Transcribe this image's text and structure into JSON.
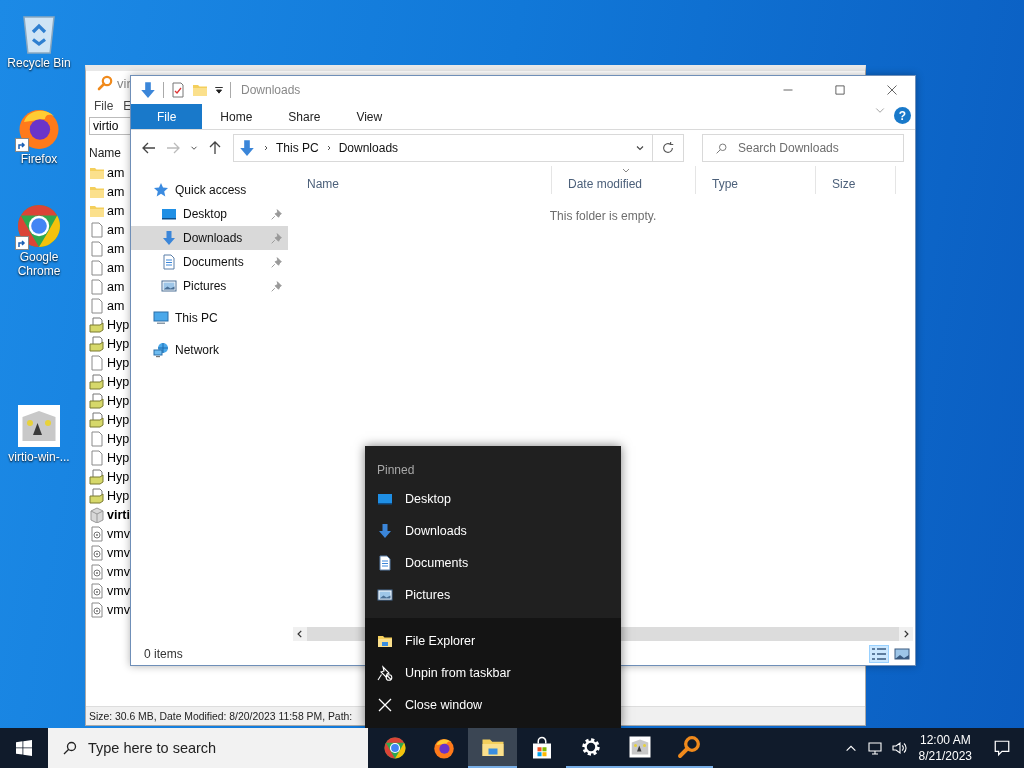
{
  "desktop_icons": [
    {
      "label": "Recycle Bin",
      "kind": "recycle",
      "shortcut": false
    },
    {
      "label": "Firefox",
      "kind": "firefox",
      "shortcut": true
    },
    {
      "label": "Google Chrome",
      "kind": "chrome",
      "shortcut": true
    },
    {
      "label": "virtio-win-...",
      "kind": "installer",
      "shortcut": false
    }
  ],
  "back_window": {
    "title": "vir",
    "menu": [
      "File",
      "E"
    ],
    "search_value": "virtio",
    "column": "Name",
    "rows": [
      {
        "name": "am",
        "kind": "folder",
        "bold": false
      },
      {
        "name": "am",
        "kind": "folder",
        "bold": false
      },
      {
        "name": "am",
        "kind": "folder",
        "bold": false
      },
      {
        "name": "am",
        "kind": "file",
        "bold": false
      },
      {
        "name": "am",
        "kind": "file",
        "bold": false
      },
      {
        "name": "am",
        "kind": "file",
        "bold": false
      },
      {
        "name": "am",
        "kind": "file",
        "bold": false
      },
      {
        "name": "am",
        "kind": "file",
        "bold": false
      },
      {
        "name": "Hyp",
        "kind": "setup",
        "bold": false
      },
      {
        "name": "Hyp",
        "kind": "setup",
        "bold": false
      },
      {
        "name": "Hyp",
        "kind": "file",
        "bold": false
      },
      {
        "name": "Hyp",
        "kind": "setup",
        "bold": false
      },
      {
        "name": "Hyp",
        "kind": "setup",
        "bold": false
      },
      {
        "name": "Hyp",
        "kind": "setup",
        "bold": false
      },
      {
        "name": "Hyp",
        "kind": "file",
        "bold": false
      },
      {
        "name": "Hyp",
        "kind": "file",
        "bold": false
      },
      {
        "name": "Hyp",
        "kind": "setup",
        "bold": false
      },
      {
        "name": "Hyp",
        "kind": "setup",
        "bold": false
      },
      {
        "name": "virti",
        "kind": "package",
        "bold": true
      },
      {
        "name": "vmv",
        "kind": "config",
        "bold": false
      },
      {
        "name": "vmv",
        "kind": "config",
        "bold": false
      },
      {
        "name": "vmv",
        "kind": "config",
        "bold": false
      },
      {
        "name": "vmv",
        "kind": "config",
        "bold": false
      },
      {
        "name": "vmv",
        "kind": "config",
        "bold": false
      }
    ],
    "status": "Size: 30.6 MB, Date Modified: 8/20/2023 11:58 PM, Path:"
  },
  "explorer": {
    "title": "Downloads",
    "ribbon_tabs": [
      {
        "label": "File",
        "selected": true
      },
      {
        "label": "Home",
        "selected": false
      },
      {
        "label": "Share",
        "selected": false
      },
      {
        "label": "View",
        "selected": false
      }
    ],
    "help_label": "?",
    "breadcrumb": [
      "This PC",
      "Downloads"
    ],
    "search": {
      "placeholder": "Search Downloads"
    },
    "columns": [
      {
        "label": "Name",
        "sorted": false
      },
      {
        "label": "Date modified",
        "sorted": true
      },
      {
        "label": "Type",
        "sorted": false
      },
      {
        "label": "Size",
        "sorted": false
      }
    ],
    "empty_message": "This folder is empty.",
    "nav": [
      {
        "label": "Quick access",
        "kind": "star",
        "selected": false,
        "pinned": false,
        "children": [
          {
            "label": "Desktop",
            "kind": "desktop",
            "selected": false,
            "pinned": true
          },
          {
            "label": "Downloads",
            "kind": "downloads",
            "selected": true,
            "pinned": true
          },
          {
            "label": "Documents",
            "kind": "documents",
            "selected": false,
            "pinned": true
          },
          {
            "label": "Pictures",
            "kind": "pictures",
            "selected": false,
            "pinned": true
          }
        ]
      },
      {
        "label": "This PC",
        "kind": "pc",
        "selected": false,
        "pinned": false
      },
      {
        "label": "Network",
        "kind": "network",
        "selected": false,
        "pinned": false
      }
    ],
    "status": "0 items",
    "views": [
      {
        "kind": "details",
        "selected": true
      },
      {
        "kind": "tiles",
        "selected": false
      }
    ]
  },
  "jump_list": {
    "header": "Pinned",
    "pinned": [
      {
        "label": "Desktop",
        "kind": "desktop"
      },
      {
        "label": "Downloads",
        "kind": "downloads"
      },
      {
        "label": "Documents",
        "kind": "documents"
      },
      {
        "label": "Pictures",
        "kind": "pictures"
      }
    ],
    "actions": [
      {
        "label": "File Explorer",
        "kind": "explorer"
      },
      {
        "label": "Unpin from taskbar",
        "kind": "unpin"
      },
      {
        "label": "Close window",
        "kind": "close"
      }
    ]
  },
  "taskbar": {
    "search": {
      "placeholder": "Type here to search"
    },
    "apps": [
      {
        "kind": "chrome",
        "running": false,
        "selected": false
      },
      {
        "kind": "firefox",
        "running": false,
        "selected": false
      },
      {
        "kind": "explorer",
        "running": true,
        "selected": true
      },
      {
        "kind": "store",
        "running": false,
        "selected": false
      },
      {
        "kind": "settings",
        "running": true,
        "selected": false
      },
      {
        "kind": "installer",
        "running": true,
        "selected": false
      },
      {
        "kind": "magnifier",
        "running": true,
        "selected": false
      }
    ],
    "time": "12:00 AM",
    "date": "8/21/2023"
  }
}
